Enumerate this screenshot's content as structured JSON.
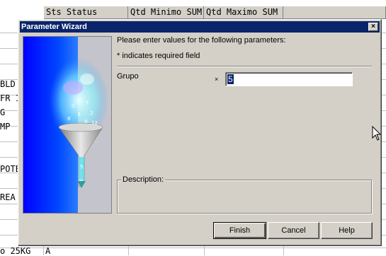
{
  "grid": {
    "headers": [
      "Sts Status",
      "Qtd Minimo SUM",
      "Qtd Maximo SUM"
    ],
    "left_cells": [
      "BLD",
      "FR 1",
      "G",
      "MP",
      "POTE",
      "REA",
      "o 25KG"
    ],
    "bottom_cell": "A"
  },
  "dialog": {
    "title": "Parameter Wizard",
    "close_glyph": "×",
    "instructions": "Please enter values for the following parameters:",
    "required_note": "* indicates required field",
    "param_label": "Grupo",
    "required_marker": "×",
    "param_value": "5",
    "description_label": "Description:",
    "buttons": {
      "finish": "Finish",
      "cancel": "Cancel",
      "help": "Help"
    }
  },
  "banner_numbers": [
    "0",
    "7",
    "3",
    "2",
    "8",
    "9",
    "12",
    "5"
  ],
  "icons": {
    "close": "close-icon",
    "funnel": "funnel-icon",
    "cursor": "mouse-pointer-icon"
  }
}
